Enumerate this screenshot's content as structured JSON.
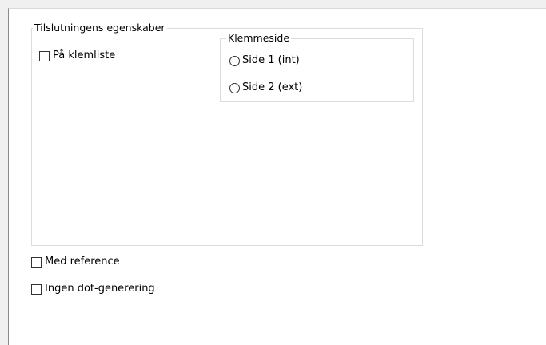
{
  "group_connection": {
    "title": "Tilslutningens egenskaber",
    "on_terminal_strip": {
      "label": "På klemliste",
      "checked": false
    }
  },
  "group_terminal_side": {
    "title": "Klemmeside",
    "options": [
      {
        "label": "Side 1 (int)",
        "selected": false
      },
      {
        "label": "Side 2 (ext)",
        "selected": false
      }
    ]
  },
  "with_reference": {
    "label": "Med reference",
    "checked": false
  },
  "no_dot_generation": {
    "label": "Ingen dot-generering",
    "checked": false
  }
}
